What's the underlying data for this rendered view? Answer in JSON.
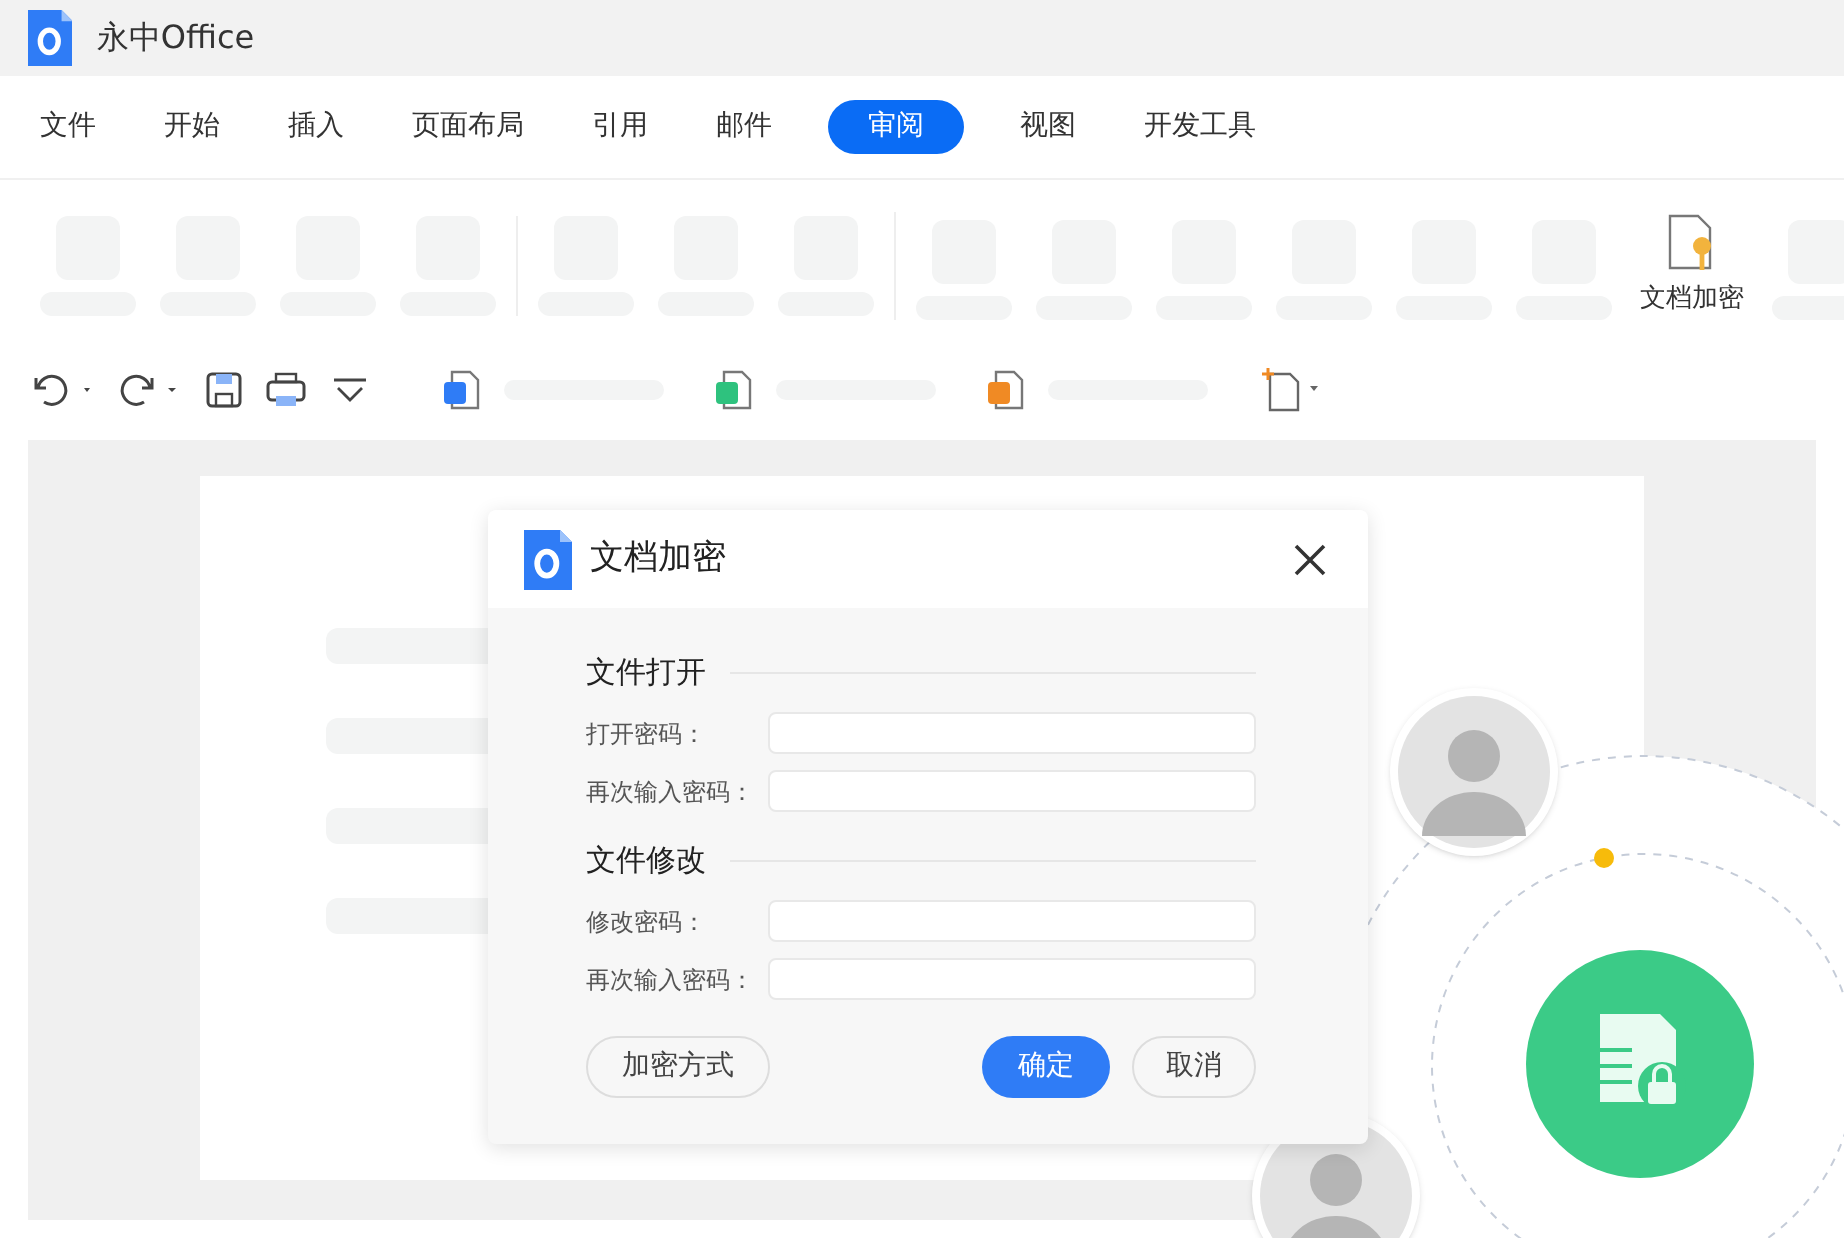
{
  "app": {
    "title": "永中Office"
  },
  "tabs": [
    {
      "label": "文件",
      "selected": false
    },
    {
      "label": "开始",
      "selected": false
    },
    {
      "label": "插入",
      "selected": false
    },
    {
      "label": "页面布局",
      "selected": false
    },
    {
      "label": "引用",
      "selected": false
    },
    {
      "label": "邮件",
      "selected": false
    },
    {
      "label": "审阅",
      "selected": true
    },
    {
      "label": "视图",
      "selected": false
    },
    {
      "label": "开发工具",
      "selected": false
    }
  ],
  "ribbon": {
    "groups": [
      {
        "items": [
          {
            "kind": "placeholder"
          },
          {
            "kind": "placeholder"
          },
          {
            "kind": "placeholder"
          },
          {
            "kind": "placeholder"
          }
        ]
      },
      {
        "items": [
          {
            "kind": "placeholder"
          },
          {
            "kind": "placeholder"
          },
          {
            "kind": "placeholder"
          }
        ]
      },
      {
        "items": [
          {
            "kind": "placeholder"
          },
          {
            "kind": "placeholder"
          },
          {
            "kind": "placeholder"
          },
          {
            "kind": "placeholder"
          },
          {
            "kind": "placeholder"
          },
          {
            "kind": "placeholder"
          },
          {
            "kind": "button",
            "label": "文档加密"
          },
          {
            "kind": "placeholder"
          }
        ]
      }
    ]
  },
  "dialog": {
    "title": "文档加密",
    "sections": [
      {
        "heading": "文件打开",
        "fields": [
          {
            "label": "打开密码："
          },
          {
            "label": "再次输入密码："
          }
        ]
      },
      {
        "heading": "文件修改",
        "fields": [
          {
            "label": "修改密码："
          },
          {
            "label": "再次输入密码："
          }
        ]
      }
    ],
    "options_button": "加密方式",
    "buttons": [
      {
        "label": "确定",
        "kind": "primary"
      },
      {
        "label": "取消",
        "kind": "secondary"
      }
    ]
  }
}
